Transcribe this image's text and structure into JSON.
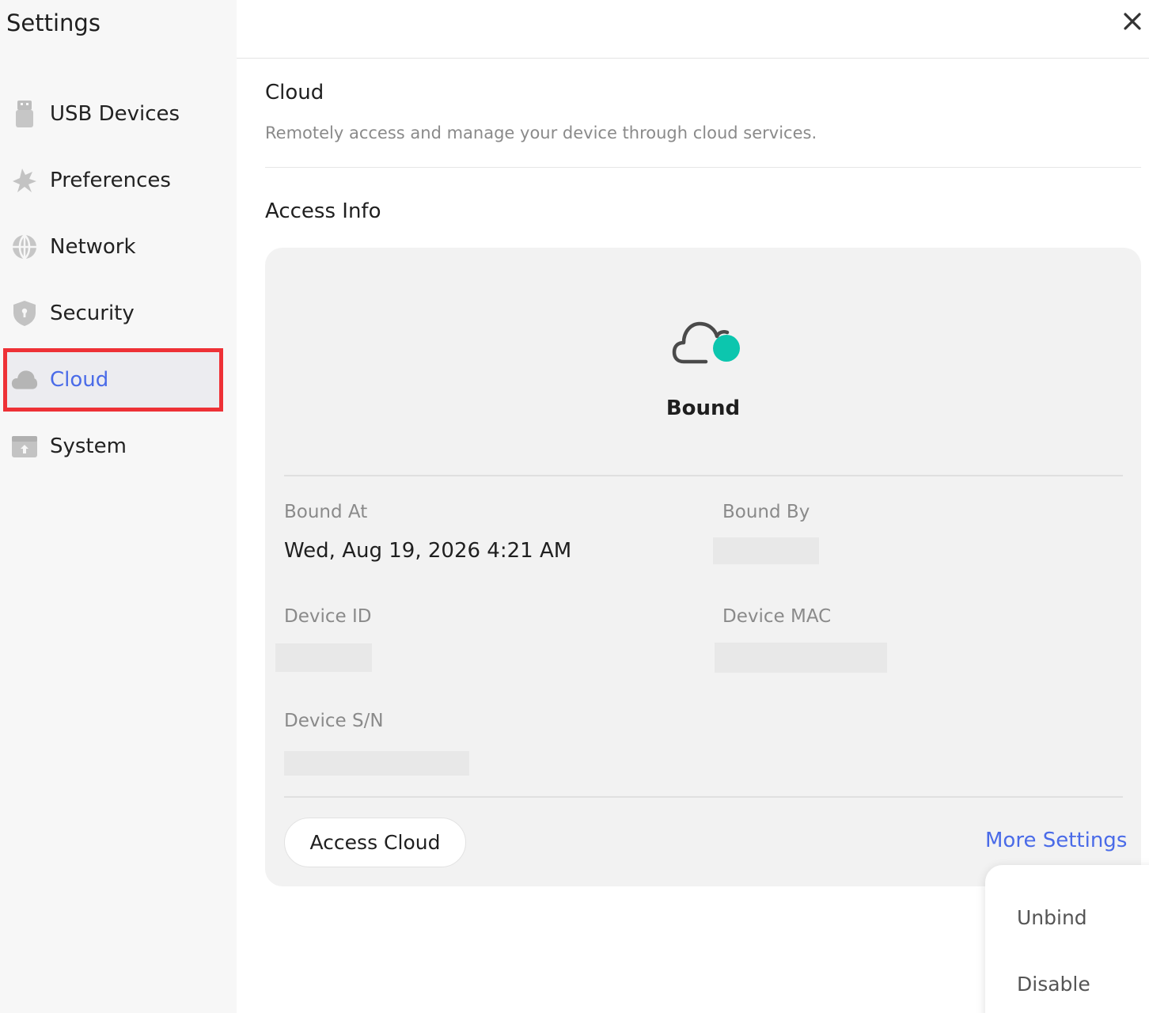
{
  "app": {
    "title": "Settings"
  },
  "sidebar": {
    "items": [
      {
        "label": "USB Devices",
        "icon": "usb-icon"
      },
      {
        "label": "Preferences",
        "icon": "preferences-icon"
      },
      {
        "label": "Network",
        "icon": "globe-icon"
      },
      {
        "label": "Security",
        "icon": "shield-icon"
      },
      {
        "label": "Cloud",
        "icon": "cloud-icon",
        "active": true
      },
      {
        "label": "System",
        "icon": "system-icon"
      }
    ]
  },
  "main": {
    "title": "Cloud",
    "description": "Remotely access and manage your device through cloud services.",
    "access_info": {
      "heading": "Access Info",
      "status": "Bound",
      "fields": {
        "bound_at_label": "Bound At",
        "bound_at_value": "Wed, Aug 19, 2026 4:21 AM",
        "bound_by_label": "Bound By",
        "device_id_label": "Device ID",
        "device_mac_label": "Device MAC",
        "device_sn_label": "Device S/N"
      },
      "access_button": "Access Cloud",
      "more_settings": "More Settings"
    },
    "dropdown": {
      "items": [
        "Unbind",
        "Disable"
      ]
    }
  },
  "colors": {
    "accent": "#4a6be8",
    "status_dot": "#0cc6ae",
    "highlight_border": "#ee3136"
  }
}
